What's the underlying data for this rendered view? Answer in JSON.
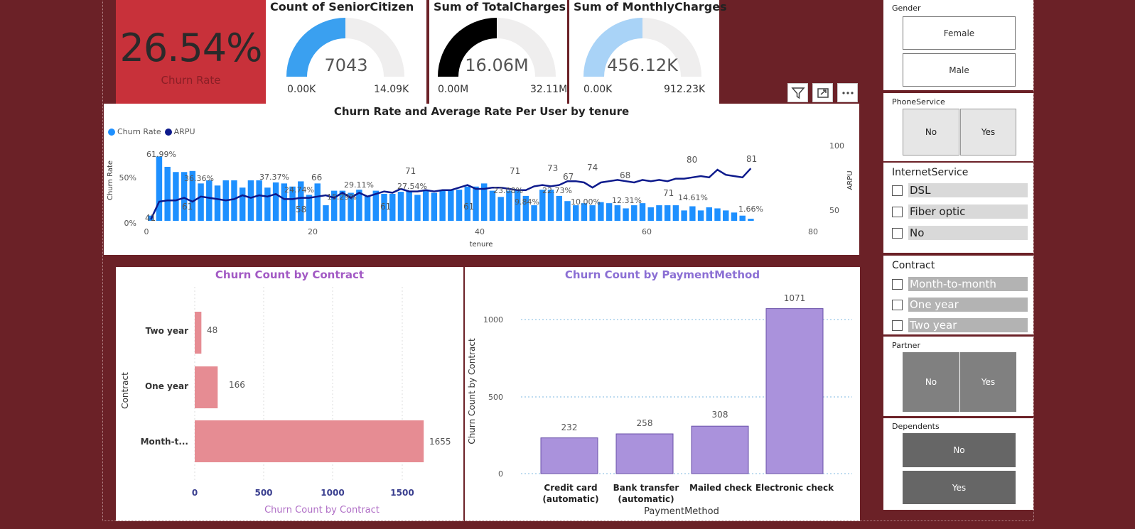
{
  "kpi": {
    "value": "26.54%",
    "label": "Churn Rate",
    "bg": "#c8313a"
  },
  "gauges": [
    {
      "title": "Count of SeniorCitizen",
      "value": "7043",
      "min": "0.00K",
      "max": "14.09K",
      "fraction": 0.5,
      "color": "#3aa0f0"
    },
    {
      "title": "Sum of TotalCharges",
      "value": "16.06M",
      "min": "0.00M",
      "max": "32.11M",
      "fraction": 0.5,
      "color": "#000000"
    },
    {
      "title": "Sum of MonthlyCharges",
      "value": "456.12K",
      "min": "0.00K",
      "max": "912.23K",
      "fraction": 0.5,
      "color": "#a9d3f7"
    }
  ],
  "toolbar": {
    "icons": [
      "filter-icon",
      "focus-mode-icon",
      "more-options-icon"
    ]
  },
  "combo_chart": {
    "title": "Churn Rate and Average Rate Per User by tenure",
    "legend": [
      "Churn Rate",
      "ARPU"
    ],
    "legend_colors": [
      "#1e90ff",
      "#0d1a8c"
    ],
    "ylabel_left": "Churn Rate",
    "ylabel_right": "ARPU",
    "xlabel": "tenure",
    "left_ticks": [
      "50%",
      "0%"
    ],
    "right_ticks": [
      "100",
      "50"
    ],
    "x_ticks": [
      "0",
      "20",
      "40",
      "60",
      "80"
    ],
    "bar_labels": [
      "61.99%",
      "36.36%",
      "37.37%",
      "24.74%",
      "15.29%",
      "29.11%",
      "27.54%",
      "23.08%",
      "9.84%",
      "22.73%",
      "10.00%",
      "12.31%",
      "14.61%",
      "1.66%"
    ],
    "line_labels": [
      "41",
      "61",
      "66",
      "58",
      "71",
      "61",
      "61",
      "71",
      "73",
      "67",
      "74",
      "68",
      "71",
      "80",
      "81"
    ]
  },
  "chart_data": [
    {
      "type": "bar+line",
      "title": "Churn Rate and Average Rate Per User by tenure",
      "xlabel": "tenure",
      "ylabel": "Churn Rate",
      "y2label": "ARPU",
      "xlim": [
        0,
        80
      ],
      "ylim": [
        0,
        0.8
      ],
      "y2lim": [
        40,
        105
      ],
      "x": [
        0,
        1,
        2,
        3,
        4,
        5,
        6,
        7,
        8,
        9,
        10,
        11,
        12,
        13,
        14,
        15,
        16,
        17,
        18,
        19,
        20,
        21,
        22,
        23,
        24,
        25,
        26,
        27,
        28,
        29,
        30,
        31,
        32,
        33,
        34,
        35,
        36,
        37,
        38,
        39,
        40,
        41,
        42,
        43,
        44,
        45,
        46,
        47,
        48,
        49,
        50,
        51,
        52,
        53,
        54,
        55,
        56,
        57,
        58,
        59,
        60,
        61,
        62,
        63,
        64,
        65,
        66,
        67,
        68,
        69,
        70,
        71,
        72
      ],
      "series": [
        {
          "name": "Churn Rate",
          "values": [
            0.05,
            0.62,
            0.52,
            0.47,
            0.47,
            0.48,
            0.36,
            0.39,
            0.34,
            0.39,
            0.39,
            0.32,
            0.39,
            0.39,
            0.32,
            0.37,
            0.36,
            0.33,
            0.38,
            0.25,
            0.36,
            0.15,
            0.29,
            0.29,
            0.27,
            0.3,
            0.24,
            0.29,
            0.26,
            0.26,
            0.28,
            0.29,
            0.25,
            0.3,
            0.27,
            0.3,
            0.3,
            0.3,
            0.33,
            0.33,
            0.36,
            0.29,
            0.23,
            0.29,
            0.29,
            0.24,
            0.15,
            0.3,
            0.3,
            0.24,
            0.19,
            0.15,
            0.17,
            0.15,
            0.18,
            0.17,
            0.15,
            0.12,
            0.15,
            0.17,
            0.13,
            0.15,
            0.15,
            0.15,
            0.1,
            0.14,
            0.1,
            0.13,
            0.12,
            0.1,
            0.08,
            0.05,
            0.02
          ]
        },
        {
          "name": "ARPU",
          "values": [
            41,
            55,
            56,
            56,
            58,
            55,
            59,
            58,
            57,
            56,
            57,
            60,
            58,
            60,
            59,
            61,
            57,
            57,
            58,
            58,
            59,
            60,
            58,
            62,
            58,
            62,
            59,
            61,
            63,
            62,
            65,
            63,
            63,
            64,
            63,
            64,
            64,
            66,
            68,
            65,
            65,
            66,
            66,
            65,
            64,
            64,
            67,
            68,
            67,
            68,
            71,
            71,
            70,
            66,
            70,
            71,
            72,
            71,
            70,
            72,
            71,
            72,
            71,
            73,
            73,
            74,
            75,
            74,
            80,
            76,
            75,
            74,
            81
          ]
        }
      ]
    },
    {
      "type": "bar",
      "orientation": "horizontal",
      "title": "Churn Count by Contract",
      "xlabel": "Churn Count by Contract",
      "ylabel": "Contract",
      "categories": [
        "Two year",
        "One year",
        "Month-t..."
      ],
      "values": [
        48,
        166,
        1655
      ],
      "xlim": [
        0,
        1700
      ],
      "x_ticks": [
        "0",
        "500",
        "1000",
        "1500"
      ],
      "color": "#e68c93"
    },
    {
      "type": "bar",
      "title": "Churn Count by PaymentMethod",
      "xlabel": "PaymentMethod",
      "ylabel": "Churn Count by Contract",
      "categories": [
        [
          "Credit card",
          "(automatic)"
        ],
        [
          "Bank transfer",
          "(automatic)"
        ],
        [
          "Mailed check"
        ],
        [
          "Electronic check"
        ]
      ],
      "values": [
        232,
        258,
        308,
        1071
      ],
      "ylim": [
        0,
        1100
      ],
      "y_ticks": [
        "1000",
        "500",
        "0"
      ],
      "color": "#aa92dc"
    }
  ],
  "slicers": {
    "gender": {
      "title": "Gender",
      "options": [
        "Female",
        "Male"
      ]
    },
    "phone": {
      "title": "PhoneService",
      "options": [
        "No",
        "Yes"
      ]
    },
    "internet": {
      "title": "InternetService",
      "options": [
        "DSL",
        "Fiber optic",
        "No"
      ]
    },
    "contract": {
      "title": "Contract",
      "options": [
        "Month-to-month",
        "One year",
        "Two year"
      ]
    },
    "partner": {
      "title": "Partner",
      "options": [
        "No",
        "Yes"
      ]
    },
    "dependents": {
      "title": "Dependents",
      "options": [
        "No",
        "Yes"
      ]
    }
  }
}
